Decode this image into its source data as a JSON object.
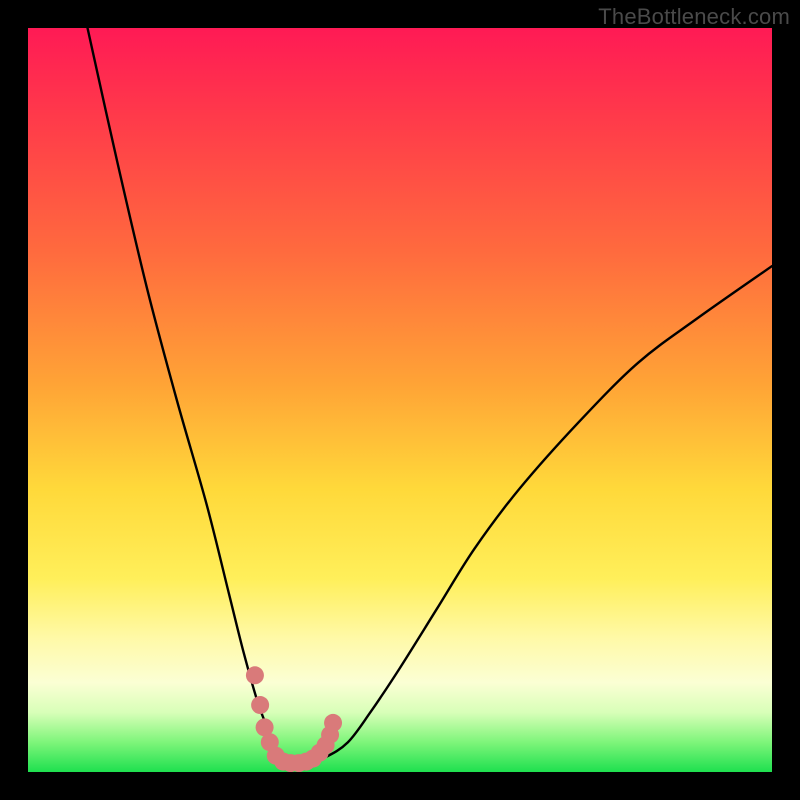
{
  "attribution": "TheBottleneck.com",
  "chart_data": {
    "type": "line",
    "title": "",
    "xlabel": "",
    "ylabel": "",
    "xlim": [
      0,
      100
    ],
    "ylim": [
      0,
      100
    ],
    "series": [
      {
        "name": "curve",
        "x": [
          8,
          12,
          16,
          20,
          24,
          27,
          29,
          31,
          33,
          34,
          35,
          37,
          40,
          43,
          46,
          50,
          55,
          60,
          66,
          74,
          82,
          90,
          100
        ],
        "y": [
          100,
          82,
          65,
          50,
          36,
          24,
          16,
          9,
          4,
          2,
          1,
          1,
          2,
          4,
          8,
          14,
          22,
          30,
          38,
          47,
          55,
          61,
          68
        ]
      }
    ],
    "markers": {
      "name": "valley-dots",
      "color": "#d97a7a",
      "points_xy": [
        [
          30.5,
          13
        ],
        [
          31.2,
          9
        ],
        [
          31.8,
          6
        ],
        [
          32.5,
          4
        ],
        [
          33.3,
          2.2
        ],
        [
          34.3,
          1.4
        ],
        [
          35.3,
          1.2
        ],
        [
          36.4,
          1.2
        ],
        [
          37.4,
          1.4
        ],
        [
          38.3,
          1.8
        ],
        [
          39.2,
          2.6
        ],
        [
          40.0,
          3.6
        ],
        [
          40.6,
          5.0
        ],
        [
          41.0,
          6.6
        ]
      ]
    },
    "background_gradient": {
      "stops": [
        {
          "pos": 0.0,
          "color": "#ff1a55"
        },
        {
          "pos": 0.3,
          "color": "#ff6a3e"
        },
        {
          "pos": 0.62,
          "color": "#ffd93a"
        },
        {
          "pos": 0.88,
          "color": "#fbffd4"
        },
        {
          "pos": 1.0,
          "color": "#1ee04f"
        }
      ]
    }
  }
}
